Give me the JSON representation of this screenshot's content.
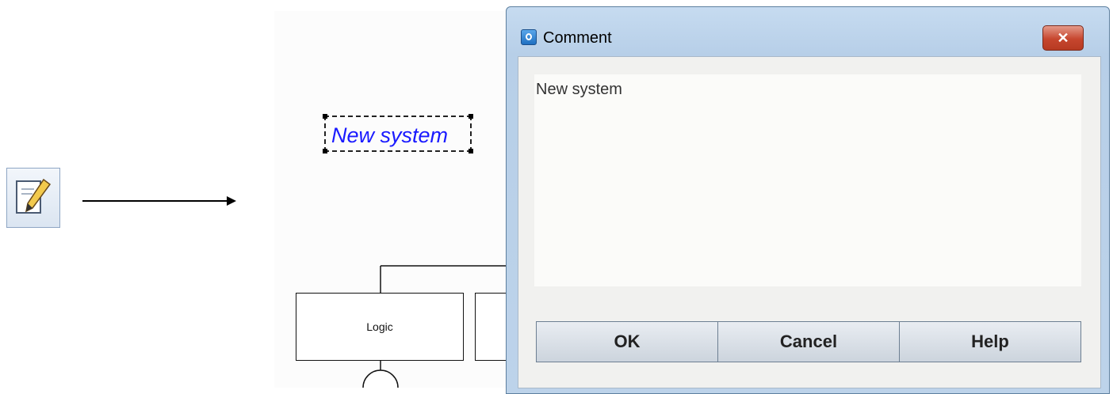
{
  "canvas": {
    "comment_label": "New system",
    "logic_block_label": "Logic"
  },
  "dialog": {
    "title": "Comment",
    "comment_text": "New system",
    "buttons": {
      "ok": "OK",
      "cancel": "Cancel",
      "help": "Help"
    }
  },
  "icons": {
    "tool": "edit-comment-icon",
    "app": "app-icon",
    "close": "close-icon"
  },
  "colors": {
    "comment_text": "#1a1aff",
    "close_button": "#c6462e"
  }
}
